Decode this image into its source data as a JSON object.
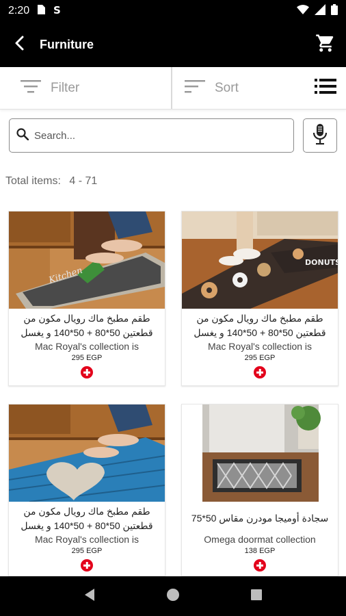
{
  "status_bar": {
    "time": "2:20",
    "icons": [
      "sim-card-icon",
      "sync-icon",
      "wifi-icon",
      "signal-icon",
      "battery-icon"
    ]
  },
  "toolbar": {
    "title": "Furniture",
    "back_icon": "chevron-left-icon",
    "cart_icon": "cart-icon"
  },
  "controls": {
    "filter_label": "Filter",
    "sort_label": "Sort",
    "view_icon": "list-view-icon"
  },
  "search": {
    "placeholder": "Search...",
    "mic_icon": "microphone-icon"
  },
  "summary": {
    "total_label": "Total items:",
    "total_value": "4 - 71"
  },
  "products": [
    {
      "title_ar": "طقم مطبخ ماك رويال مكون من قطعتين 50*80 + 50*140 و يغسل",
      "title_en": "Mac Royal's collection is",
      "price": "295 EGP",
      "image": "gray-kitchen-rug-photo"
    },
    {
      "title_ar": "طقم مطبخ ماك رويال مكون من قطعتين 50*80 + 50*140 و يغسل",
      "title_en": "Mac Royal's collection is",
      "price": "295 EGP",
      "image": "donuts-kitchen-rug-photo"
    },
    {
      "title_ar": "طقم مطبخ ماك رويال مكون من قطعتين 50*80 + 50*140 و يغسل",
      "title_en": "Mac Royal's collection is",
      "price": "295 EGP",
      "image": "blue-heart-rug-photo"
    },
    {
      "title_ar": "سجادة أوميجا مودرن مقاس 50*75",
      "title_en": "Omega doormat collection",
      "price": "138 EGP",
      "image": "gray-doormat-photo"
    }
  ],
  "nav_bar": {
    "icons": [
      "back-triangle-icon",
      "home-circle-icon",
      "recents-square-icon"
    ]
  },
  "colors": {
    "bar_background": "#000000",
    "add_button": "#e3001b"
  }
}
